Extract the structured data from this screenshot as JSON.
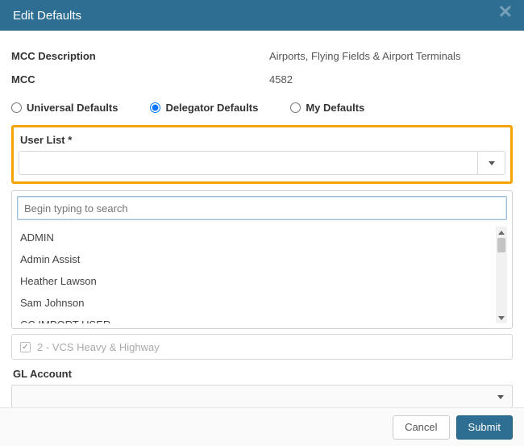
{
  "header": {
    "title": "Edit Defaults"
  },
  "info": {
    "mcc_description_label": "MCC Description",
    "mcc_description_value": "Airports, Flying Fields & Airport Terminals",
    "mcc_label": "MCC",
    "mcc_value": "4582"
  },
  "defaults": {
    "options": [
      {
        "label": "Universal Defaults",
        "selected": false
      },
      {
        "label": "Delegator Defaults",
        "selected": true
      },
      {
        "label": "My Defaults",
        "selected": false
      }
    ]
  },
  "user_list": {
    "label": "User List *",
    "search_placeholder": "Begin typing to search",
    "options": [
      "ADMIN",
      "Admin Assist",
      "Heather Lawson",
      "Sam Johnson",
      "CC IMPORT USER"
    ]
  },
  "ghost_row": {
    "label": "2 - VCS Heavy & Highway"
  },
  "gl_account": {
    "label": "GL Account"
  },
  "footer": {
    "cancel": "Cancel",
    "submit": "Submit"
  }
}
